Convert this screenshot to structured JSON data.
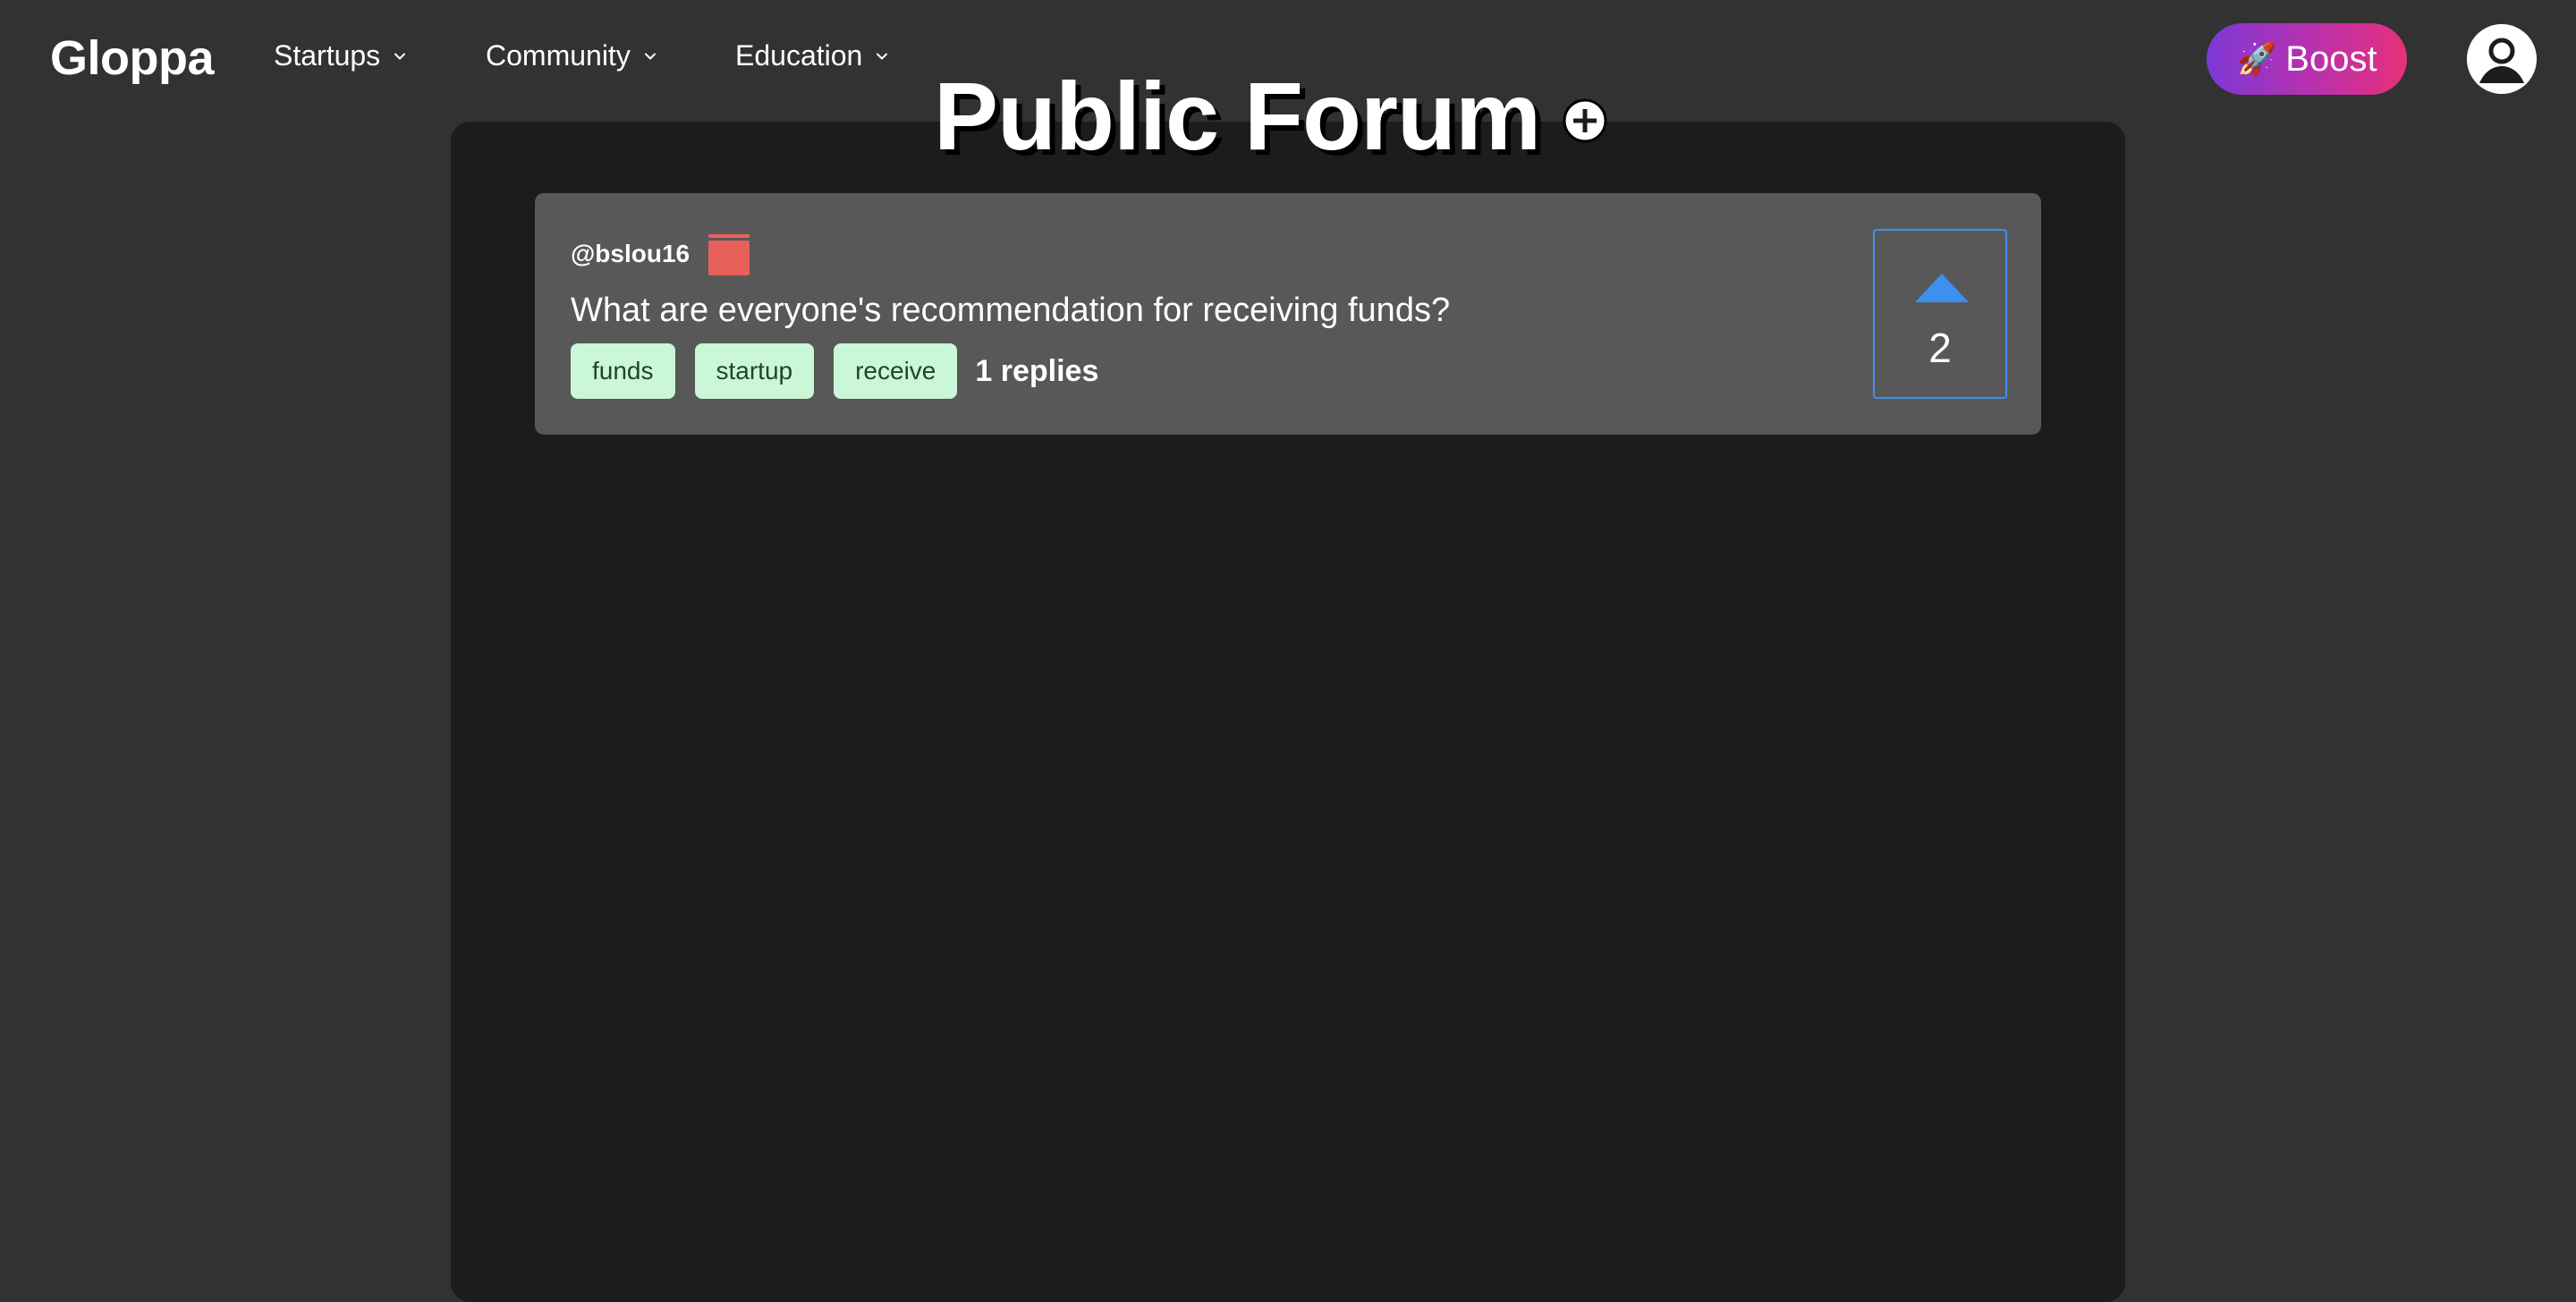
{
  "header": {
    "brand": "Gloppa",
    "nav": [
      {
        "label": "Startups"
      },
      {
        "label": "Community"
      },
      {
        "label": "Education"
      }
    ],
    "boost_label": "Boost",
    "boost_icon": "🚀",
    "boost_gradient": [
      "#7d38d6",
      "#e8307a"
    ]
  },
  "main": {
    "title": "Public Forum",
    "posts": [
      {
        "author": "@bslou16",
        "question": "What are everyone's recommendation for receiving funds?",
        "tags": [
          "funds",
          "startup",
          "receive"
        ],
        "replies": "1 replies",
        "votes": "2"
      }
    ]
  },
  "colors": {
    "page_bg": "#323232",
    "panel_bg": "#1c1c1c",
    "card_bg": "#585858",
    "tag_bg": "#c9f7d7",
    "trash": "#e8605a",
    "vote_accent": "#3d8ff0"
  },
  "icons": {
    "chevron": "chevron-down-icon",
    "add": "plus-circle-icon",
    "trash": "trash-icon",
    "upvote": "triangle-up-icon",
    "avatar": "user-avatar-icon"
  }
}
